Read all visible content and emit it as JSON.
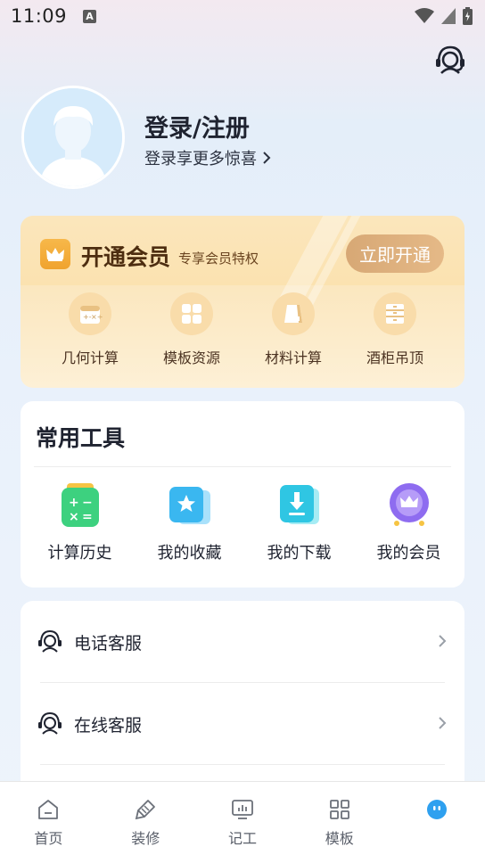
{
  "status": {
    "time": "11:09",
    "badge": "A"
  },
  "profile": {
    "title": "登录/注册",
    "subtitle": "登录享更多惊喜"
  },
  "vip": {
    "title": "开通会员",
    "subtitle": "专享会员特权",
    "button": "立即开通",
    "items": [
      {
        "label": "几何计算",
        "icon": "calculator-icon"
      },
      {
        "label": "模板资源",
        "icon": "grid-icon"
      },
      {
        "label": "材料计算",
        "icon": "material-icon"
      },
      {
        "label": "酒柜吊顶",
        "icon": "cabinet-icon"
      }
    ]
  },
  "tools": {
    "title": "常用工具",
    "items": [
      {
        "label": "计算历史",
        "icon": "calculator-icon",
        "color": "#3dd17f"
      },
      {
        "label": "我的收藏",
        "icon": "star-icon",
        "color": "#3ab7f0"
      },
      {
        "label": "我的下载",
        "icon": "download-icon",
        "color": "#2fc6e3"
      },
      {
        "label": "我的会员",
        "icon": "crown-icon",
        "color": "#8e6cf0"
      }
    ]
  },
  "services": [
    {
      "label": "电话客服",
      "icon": "headset-icon"
    },
    {
      "label": "在线客服",
      "icon": "headset-icon"
    }
  ],
  "tabs": [
    {
      "label": "首页",
      "icon": "home-icon"
    },
    {
      "label": "装修",
      "icon": "brush-icon"
    },
    {
      "label": "记工",
      "icon": "chart-board-icon"
    },
    {
      "label": "模板",
      "icon": "grid-icon"
    },
    {
      "label": "",
      "icon": "profile-blob-icon",
      "active": true,
      "color": "#2ea0ef"
    }
  ]
}
